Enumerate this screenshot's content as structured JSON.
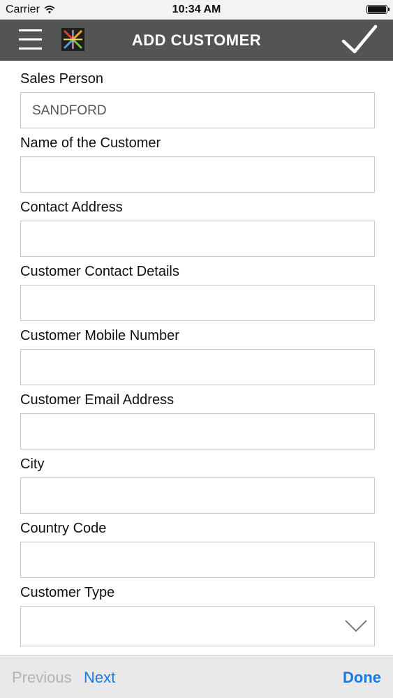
{
  "status_bar": {
    "carrier": "Carrier",
    "time": "10:34 AM"
  },
  "header": {
    "title": "ADD CUSTOMER"
  },
  "form": {
    "sales_person": {
      "label": "Sales Person",
      "value": "SANDFORD"
    },
    "customer_name": {
      "label": "Name of the Customer",
      "value": ""
    },
    "contact_address": {
      "label": "Contact Address",
      "value": ""
    },
    "contact_details": {
      "label": "Customer Contact Details",
      "value": ""
    },
    "mobile_number": {
      "label": "Customer Mobile Number",
      "value": ""
    },
    "email_address": {
      "label": "Customer Email Address",
      "value": ""
    },
    "city": {
      "label": "City",
      "value": ""
    },
    "country_code": {
      "label": "Country Code",
      "value": ""
    },
    "customer_type": {
      "label": "Customer Type",
      "value": ""
    }
  },
  "keyboard_toolbar": {
    "previous": "Previous",
    "next": "Next",
    "done": "Done"
  },
  "colors": {
    "nav_background": "#535554",
    "accent": "#1a79e6",
    "disabled": "#b3b3b3"
  }
}
